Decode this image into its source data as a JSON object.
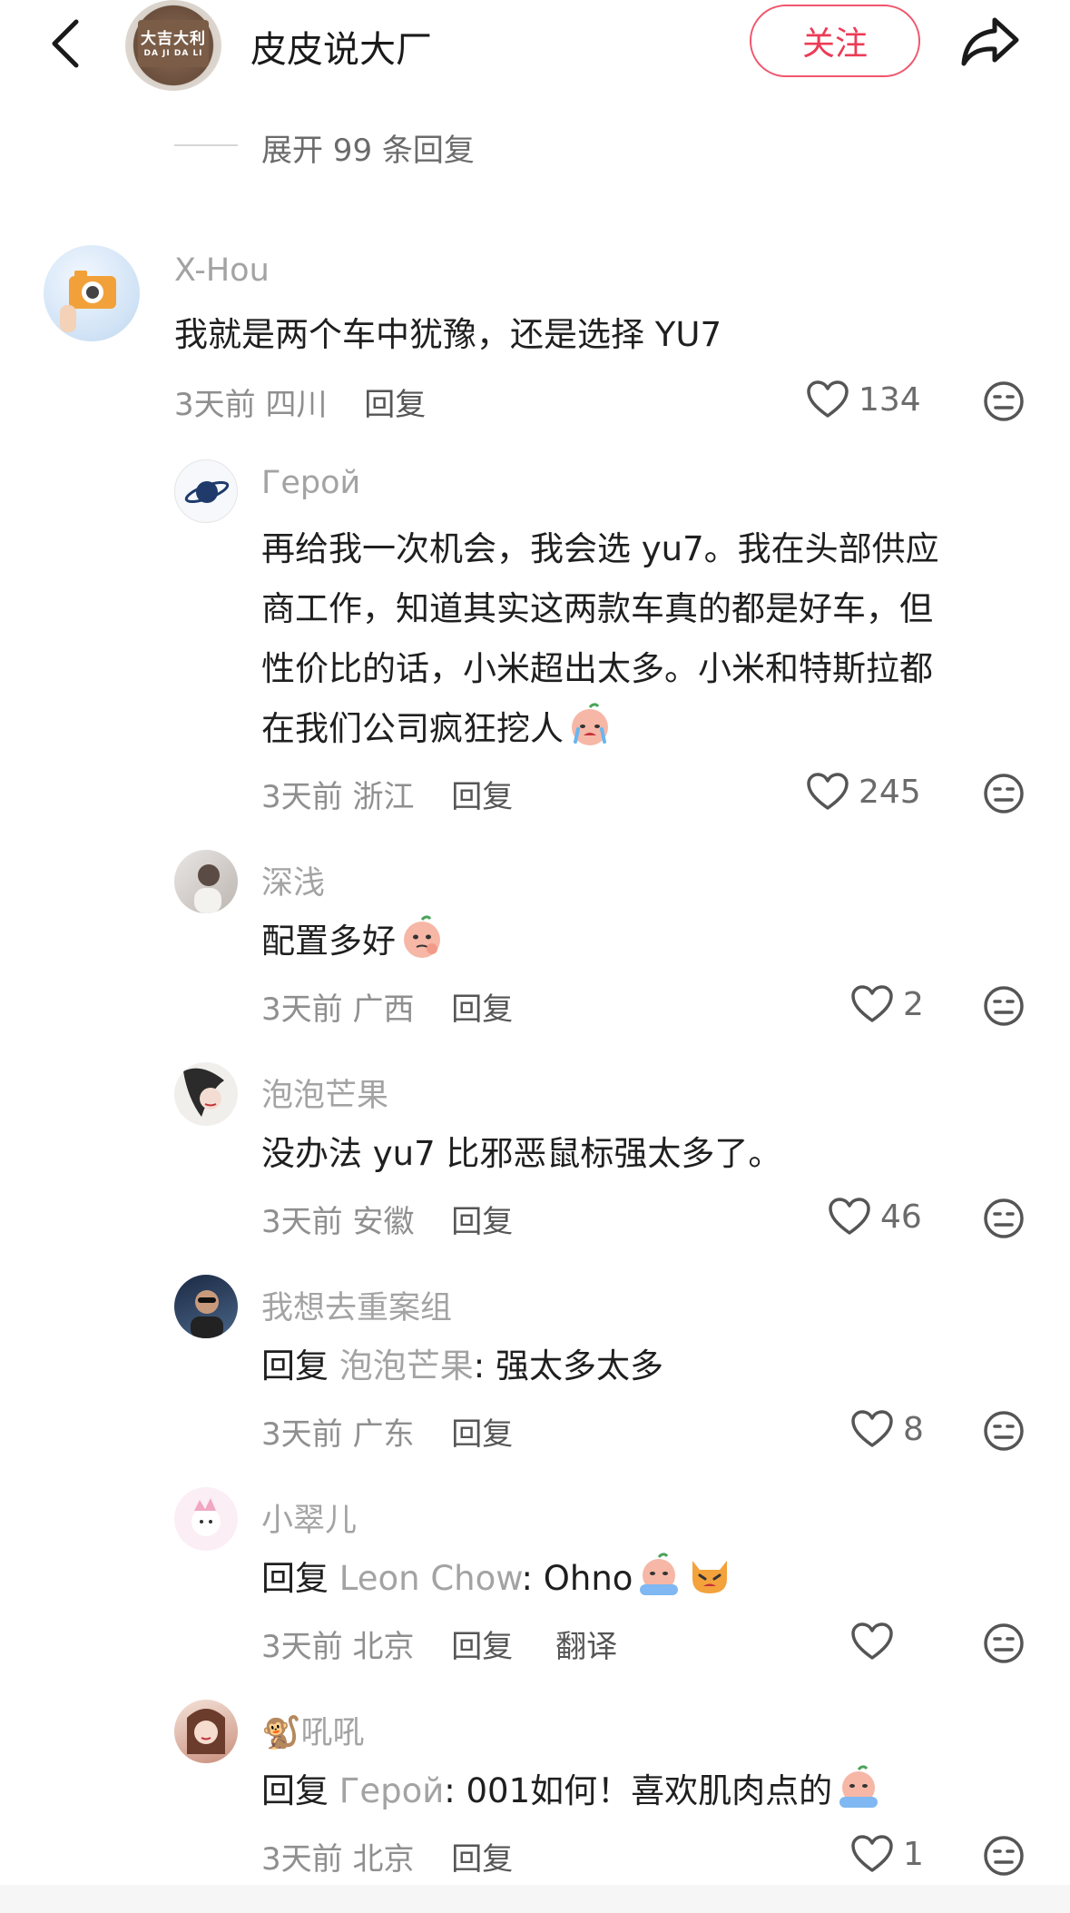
{
  "header": {
    "channel_name": "皮皮说大厂",
    "avatar_text_top": "大吉大利",
    "avatar_text_bottom": "DA JI DA LI",
    "follow_label": "关注",
    "back_icon": "chevron-left-icon",
    "share_icon": "share-arrow-icon"
  },
  "expand": {
    "label": "展开 99 条回复"
  },
  "accent_color": "#ec3b56",
  "comments": [
    {
      "username": "X-Hou",
      "text": "我就是两个车中犹豫，还是选择 YU7",
      "time": "3天前",
      "location": "四川",
      "reply_label": "回复",
      "likes": "134"
    },
    {
      "username": "Герой",
      "text_lines": [
        "再给我一次机会，我会选 yu7。我在头部供应",
        "商工作，知道其实这两款车真的都是好车，但",
        "性价比的话，小米超出太多。小米和特斯拉都",
        "在我们公司疯狂挖人"
      ],
      "time": "3天前",
      "location": "浙江",
      "reply_label": "回复",
      "likes": "245"
    },
    {
      "username": "深浅",
      "text": "配置多好",
      "time": "3天前",
      "location": "广西",
      "reply_label": "回复",
      "likes": "2"
    },
    {
      "username": "泡泡芒果",
      "text": "没办法 yu7 比邪恶鼠标强太多了。",
      "time": "3天前",
      "location": "安徽",
      "reply_label": "回复",
      "likes": "46"
    },
    {
      "username": "我想去重案组",
      "reply_prefix": "回复",
      "reply_to": "泡泡芒果",
      "text": ": 强太多太多",
      "time": "3天前",
      "location": "广东",
      "reply_label": "回复",
      "likes": "8"
    },
    {
      "username": "小翠儿",
      "reply_prefix": "回复",
      "reply_to": "Leon Chow",
      "text": ": Ohno",
      "time": "3天前",
      "location": "北京",
      "reply_label": "回复",
      "translate_label": "翻译",
      "likes": ""
    },
    {
      "username": "吼吼",
      "username_emoji": "🐒",
      "reply_prefix": "回复",
      "reply_to": "Герой",
      "text": ": 001如何！喜欢肌肉点的",
      "time": "3天前",
      "location": "北京",
      "reply_label": "回复",
      "likes": "1"
    }
  ]
}
